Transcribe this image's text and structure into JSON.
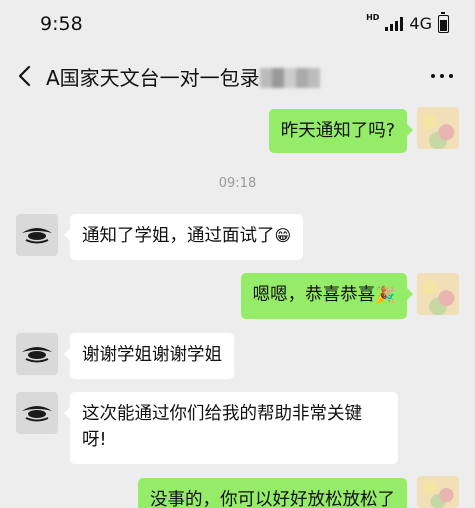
{
  "status_bar": {
    "time": "9:58",
    "hd_label": "HD",
    "network": "4G"
  },
  "header": {
    "title": "A国家天文台一对一包录"
  },
  "messages": [
    {
      "sender": "self",
      "text": "昨天通知了吗?"
    },
    {
      "type": "timestamp",
      "text": "09:18"
    },
    {
      "sender": "other",
      "text": "通知了学姐，通过面试了",
      "emoji": "😁"
    },
    {
      "sender": "self",
      "text": "嗯嗯，恭喜恭喜",
      "emoji": "🎉"
    },
    {
      "sender": "other",
      "text": "谢谢学姐谢谢学姐"
    },
    {
      "sender": "other",
      "text": "这次能通过你们给我的帮助非常关键",
      "text_line2": "呀!"
    },
    {
      "sender": "self",
      "text": "没事的，你可以好好放松放松了"
    }
  ]
}
